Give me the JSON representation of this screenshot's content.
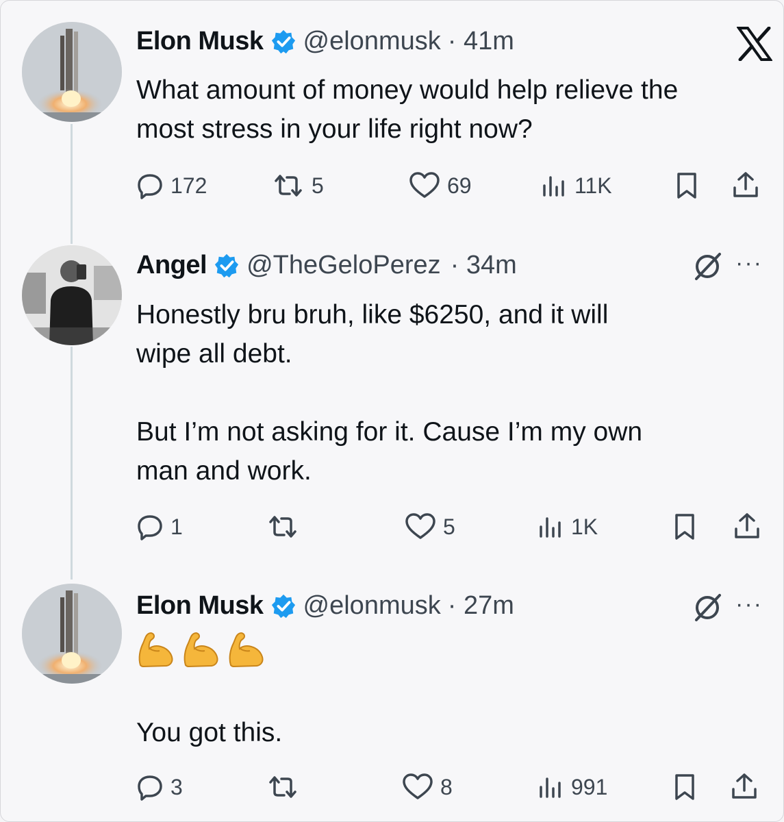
{
  "brand": {
    "logo": "X",
    "accent": "#1d9bf0"
  },
  "tweets": [
    {
      "author": "Elon Musk",
      "handle": "@elonmusk",
      "time": "· 41m",
      "verified": true,
      "avatar": "rocket-launch-avatar",
      "text": "What amount of money would help relieve the\nmost stress in your life right now?",
      "stats": {
        "replies": "172",
        "reposts": "5",
        "likes": "69",
        "views": "11K"
      }
    },
    {
      "author": "Angel",
      "handle": "@TheGeloPerez",
      "time": "· 34m",
      "verified": true,
      "avatar": "person-selfie-avatar",
      "text": "Honestly bru bruh, like $6250, and it will\nwipe all debt.\n\nBut I’m not asking for it. Cause I’m my own\nman and work.",
      "stats": {
        "replies": "1",
        "reposts": "",
        "likes": "5",
        "views": "1K"
      }
    },
    {
      "author": "Elon Musk",
      "handle": "@elonmusk",
      "time": "· 27m",
      "verified": true,
      "avatar": "rocket-launch-avatar",
      "emojis": [
        "flexed-biceps",
        "flexed-biceps",
        "flexed-biceps"
      ],
      "text": "You got this.",
      "stats": {
        "replies": "3",
        "reposts": "",
        "likes": "8",
        "views": "991"
      }
    }
  ],
  "icons": {
    "reply": "reply-icon",
    "repost": "repost-icon",
    "like": "like-icon",
    "views": "views-icon",
    "bookmark": "bookmark-icon",
    "share": "share-icon",
    "more": "more-icon",
    "grok": "grok-icon"
  },
  "more_label": "···"
}
